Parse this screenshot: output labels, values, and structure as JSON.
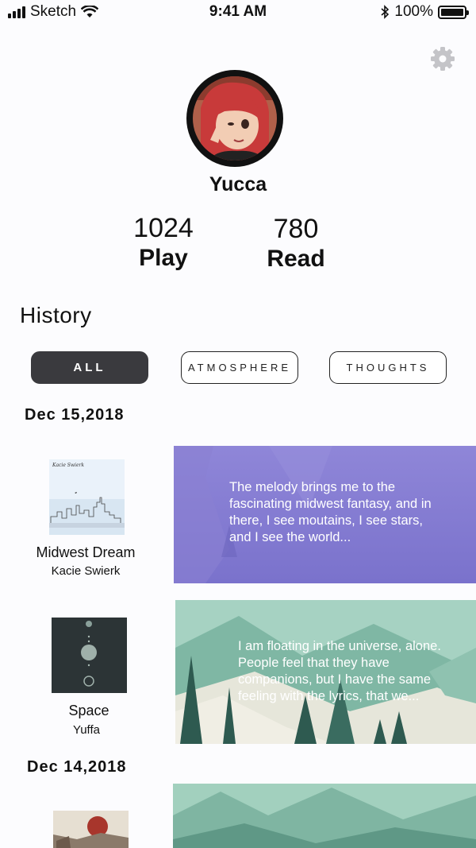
{
  "status_bar": {
    "carrier": "Sketch",
    "time": "9:41 AM",
    "battery": "100%",
    "battery_level": 1.0
  },
  "profile": {
    "username": "Yucca",
    "stats": [
      {
        "value": "1024",
        "label": "Play"
      },
      {
        "value": "780",
        "label": "Read"
      }
    ]
  },
  "history": {
    "title": "History",
    "filters": [
      {
        "label": "ALL",
        "active": true
      },
      {
        "label": "ATMOSPHERE",
        "active": false
      },
      {
        "label": "THOUGHTS",
        "active": false
      }
    ],
    "groups": [
      {
        "date": "Dec 15,2018",
        "entries": [
          {
            "song": "Midwest Dream",
            "artist": "Kacie Swierk",
            "cover_caption": "Kacie Swierk",
            "excerpt": "The melody brings me to the fascinating midwest fantasy, and in there, I see moutains, I see stars, and I see the world..."
          },
          {
            "song": "Space",
            "artist": "Yuffa",
            "excerpt": "I am floating in the universe, alone. People feel that they have companions, but I have the same feeling with the lyrics, that we..."
          }
        ]
      },
      {
        "date": "Dec 14,2018",
        "entries": []
      }
    ]
  },
  "colors": {
    "accent_dark": "#3a3a3e",
    "card_purple": "#8a82d6",
    "card_teal": "#7fb7a4"
  },
  "icons": {
    "settings": "gear-icon",
    "wifi": "wifi-icon",
    "bluetooth": "bluetooth-icon",
    "signal": "signal-icon",
    "battery": "battery-icon"
  }
}
